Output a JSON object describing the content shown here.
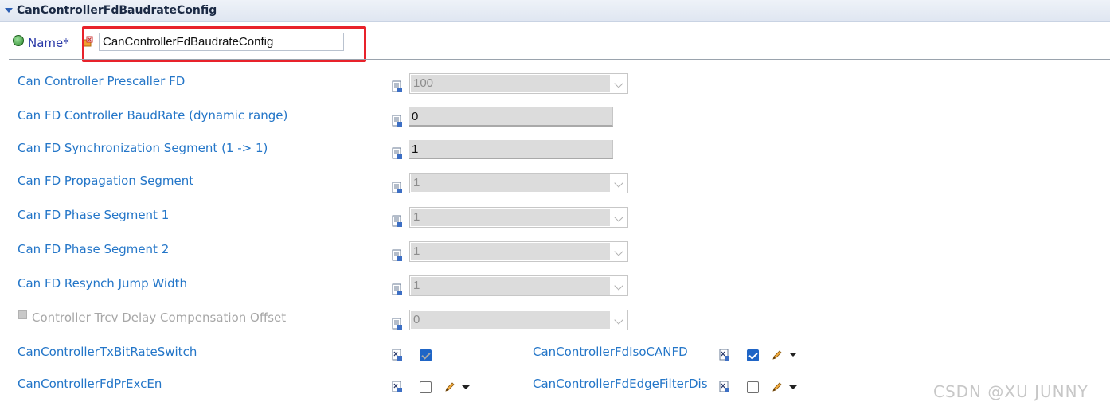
{
  "section": {
    "title": "CanControllerFdBaudrateConfig"
  },
  "name_field": {
    "label": "Name*",
    "value": "CanControllerFdBaudrateConfig"
  },
  "params": [
    {
      "label": "Can Controller Prescaller FD",
      "value": "100",
      "kind": "combo"
    },
    {
      "label": "Can FD Controller BaudRate (dynamic range)",
      "value": "0",
      "kind": "text"
    },
    {
      "label": "Can FD Synchronization Segment (1 -> 1)",
      "value": "1",
      "kind": "text"
    },
    {
      "label": "Can FD Propagation Segment",
      "value": "1",
      "kind": "combo"
    },
    {
      "label": "Can FD Phase Segment 1",
      "value": "1",
      "kind": "combo"
    },
    {
      "label": "Can FD Phase Segment 2",
      "value": "1",
      "kind": "combo"
    },
    {
      "label": "Can FD Resynch Jump Width",
      "value": "1",
      "kind": "combo"
    },
    {
      "label": "Controller Trcv Delay Compensation Offset",
      "value": "0",
      "kind": "combo",
      "enabled": false
    }
  ],
  "booleans": [
    {
      "label": "CanControllerTxBitRateSwitch",
      "checked": true,
      "enabled": false
    },
    {
      "label": "CanControllerFdIsoCANFD",
      "checked": true,
      "enabled": true
    },
    {
      "label": "CanControllerFdPrExcEn",
      "checked": false,
      "enabled": true
    },
    {
      "label": "CanControllerFdEdgeFilterDis",
      "checked": false,
      "enabled": true
    }
  ],
  "watermark": "CSDN @XU JUNNY",
  "colors": {
    "label": "#2476c8",
    "highlight": "#e8222b",
    "check": "#1f65c6"
  }
}
